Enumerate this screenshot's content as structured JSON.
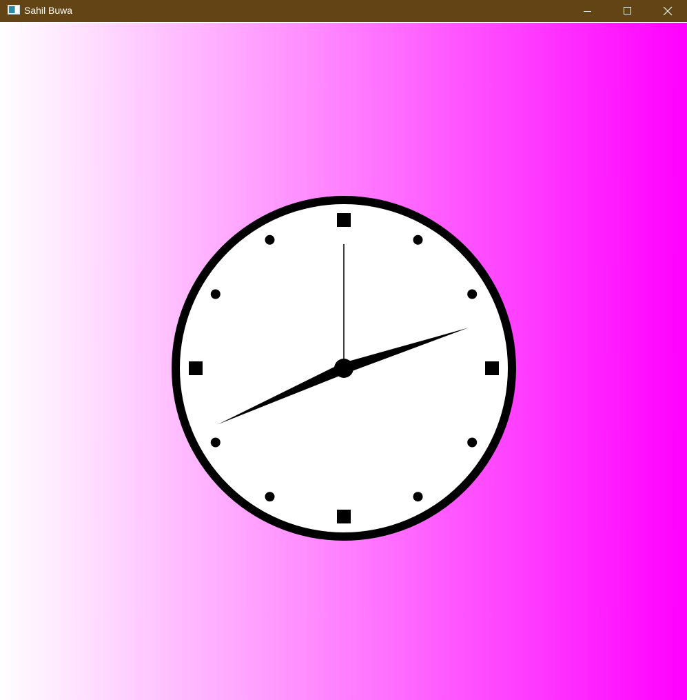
{
  "window": {
    "title": "Sahil Buwa",
    "titlebar_color": "#634414"
  },
  "icons": {
    "app": "app-window-icon",
    "minimize": "minimize-icon",
    "maximize": "maximize-icon",
    "close": "close-icon"
  },
  "background": {
    "gradient_start": "#ffffff",
    "gradient_end": "#ff00ff"
  },
  "clock": {
    "face_color": "#ffffff",
    "rim_color": "#000000",
    "time": {
      "hours": 8,
      "minutes": 12,
      "seconds": 0
    }
  }
}
